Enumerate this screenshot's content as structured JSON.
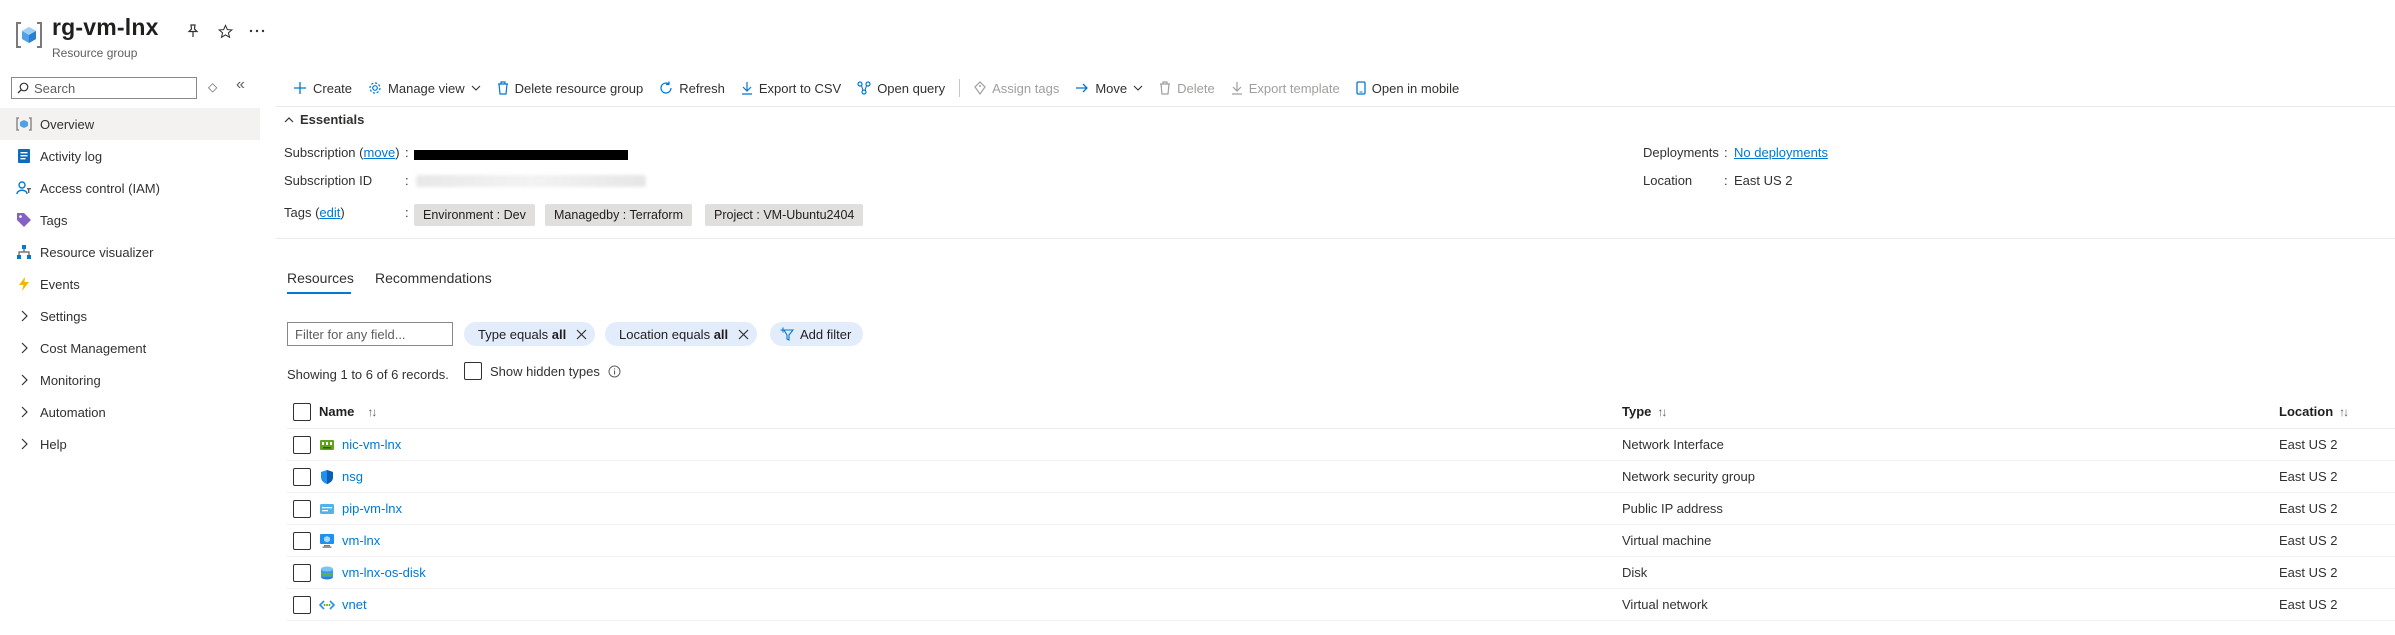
{
  "header": {
    "title": "rg-vm-lnx",
    "subtitle": "Resource group"
  },
  "nav": {
    "search_placeholder": "Search",
    "items": [
      {
        "label": "Overview",
        "icon": "overview-icon",
        "active": true
      },
      {
        "label": "Activity log",
        "icon": "activity-log-icon"
      },
      {
        "label": "Access control (IAM)",
        "icon": "iam-icon"
      },
      {
        "label": "Tags",
        "icon": "tag-icon"
      },
      {
        "label": "Resource visualizer",
        "icon": "visualizer-icon"
      },
      {
        "label": "Events",
        "icon": "lightning-icon"
      },
      {
        "label": "Settings",
        "icon": "chevron-right-icon"
      },
      {
        "label": "Cost Management",
        "icon": "chevron-right-icon"
      },
      {
        "label": "Monitoring",
        "icon": "chevron-right-icon"
      },
      {
        "label": "Automation",
        "icon": "chevron-right-icon"
      },
      {
        "label": "Help",
        "icon": "chevron-right-icon"
      }
    ]
  },
  "toolbar": {
    "create": "Create",
    "manage_view": "Manage view",
    "delete_rg": "Delete resource group",
    "refresh": "Refresh",
    "export_csv": "Export to CSV",
    "open_query": "Open query",
    "assign_tags": "Assign tags",
    "move": "Move",
    "delete": "Delete",
    "export_template": "Export template",
    "open_mobile": "Open in mobile"
  },
  "essentials": {
    "heading": "Essentials",
    "subscription_label": "Subscription",
    "move_link": "move",
    "subscription_id_label": "Subscription ID",
    "tags_label": "Tags",
    "edit_link": "edit",
    "tags": [
      "Environment : Dev",
      "Managedby : Terraform",
      "Project : VM-Ubuntu2404"
    ],
    "deployments_label": "Deployments",
    "deployments_value": "No deployments",
    "location_label": "Location",
    "location_value": "East US 2"
  },
  "tabs": [
    "Resources",
    "Recommendations"
  ],
  "filters": {
    "field_placeholder": "Filter for any field...",
    "type_prefix": "Type equals",
    "type_value": "all",
    "location_prefix": "Location equals",
    "location_value": "all",
    "add_filter": "Add filter"
  },
  "records_text": "Showing 1 to 6 of 6 records.",
  "show_hidden_types": "Show hidden types",
  "table": {
    "columns": [
      "Name",
      "Type",
      "Location"
    ],
    "rows": [
      {
        "name": "nic-vm-lnx",
        "type": "Network Interface",
        "location": "East US 2",
        "icon": "network-interface-icon"
      },
      {
        "name": "nsg",
        "type": "Network security group",
        "location": "East US 2",
        "icon": "network-security-group-icon"
      },
      {
        "name": "pip-vm-lnx",
        "type": "Public IP address",
        "location": "East US 2",
        "icon": "public-ip-icon"
      },
      {
        "name": "vm-lnx",
        "type": "Virtual machine",
        "location": "East US 2",
        "icon": "virtual-machine-icon"
      },
      {
        "name": "vm-lnx-os-disk",
        "type": "Disk",
        "location": "East US 2",
        "icon": "disk-icon"
      },
      {
        "name": "vnet",
        "type": "Virtual network",
        "location": "East US 2",
        "icon": "virtual-network-icon"
      }
    ]
  }
}
